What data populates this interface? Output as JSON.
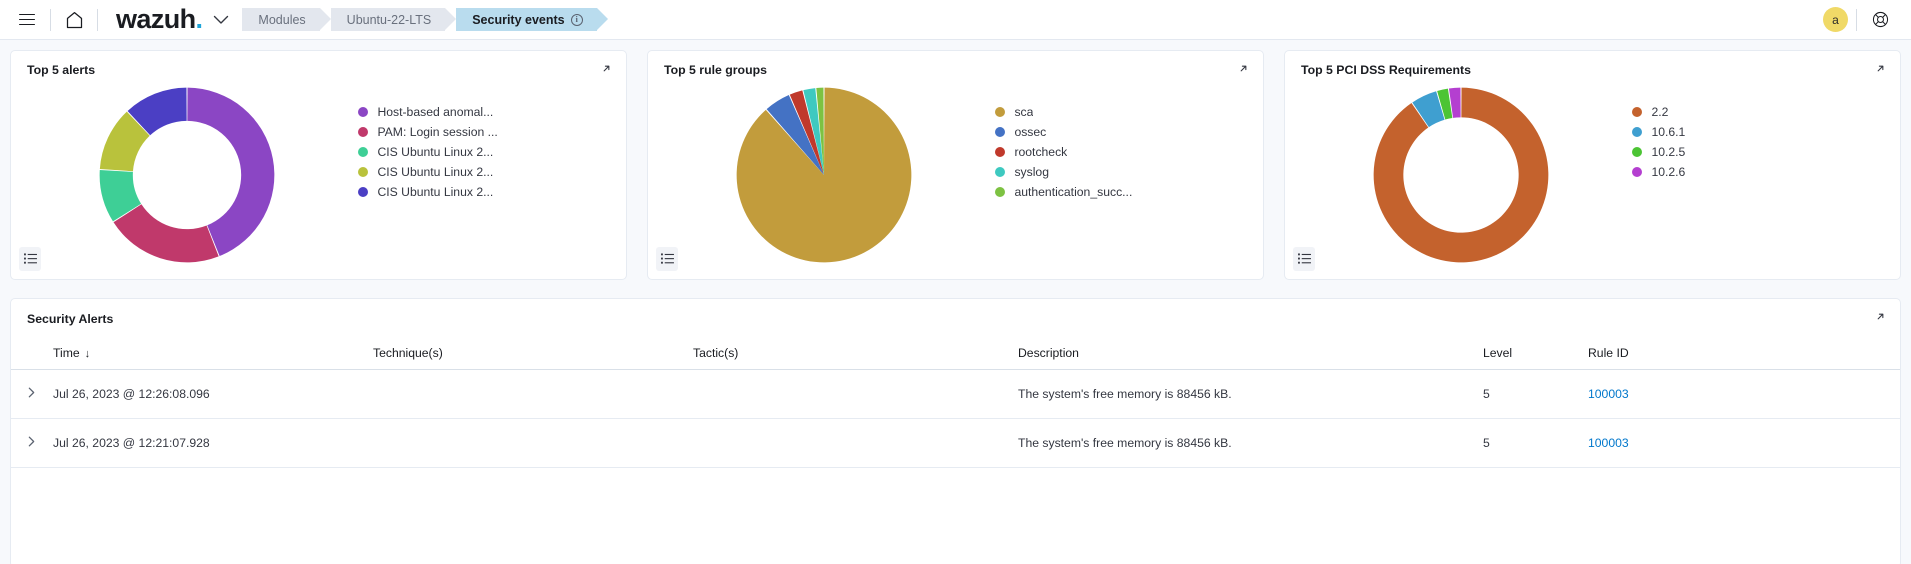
{
  "header": {
    "menu_icon": "hamburger-menu-icon",
    "home_icon": "home-icon",
    "logo_text": "wazuh",
    "logo_dot": ".",
    "chevron_icon": "chevron-down-icon",
    "breadcrumbs": [
      {
        "label": "Modules",
        "active": false
      },
      {
        "label": "Ubuntu-22-LTS",
        "active": false
      },
      {
        "label": "Security events",
        "active": true,
        "info_icon": "info-circle-icon",
        "info_glyph": "i"
      }
    ],
    "avatar_initial": "a",
    "avatar_color": "#f0d967",
    "help_icon": "help-lifebuoy-icon"
  },
  "panels": [
    {
      "title": "Top 5 alerts",
      "expand_icon": "expand-panel-icon",
      "inspect_icon": "inspect-list-icon",
      "chart_data": {
        "type": "pie",
        "title": "Top 5 alerts",
        "donut": true,
        "inner_radius_ratio": 0.62,
        "legend_position": "right",
        "labels": [
          "Host-based anomal...",
          "PAM: Login session ...",
          "CIS Ubuntu Linux 2...",
          "CIS Ubuntu Linux 2...",
          "CIS Ubuntu Linux 2..."
        ],
        "values": [
          44,
          22,
          10,
          12,
          12
        ],
        "colors": [
          "#8b46c4",
          "#c0396b",
          "#3ecf96",
          "#b9c23c",
          "#4b3fc4"
        ]
      }
    },
    {
      "title": "Top 5 rule groups",
      "expand_icon": "expand-panel-icon",
      "inspect_icon": "inspect-list-icon",
      "chart_data": {
        "type": "pie",
        "title": "Top 5 rule groups",
        "donut": false,
        "inner_radius_ratio": 0,
        "legend_position": "right",
        "labels": [
          "sca",
          "ossec",
          "rootcheck",
          "syslog",
          "authentication_succ..."
        ],
        "values": [
          88.5,
          5.0,
          2.6,
          2.4,
          1.5
        ],
        "colors": [
          "#c29c3c",
          "#4472c4",
          "#c0392b",
          "#3ec9c0",
          "#7dc242"
        ]
      }
    },
    {
      "title": "Top 5 PCI DSS Requirements",
      "expand_icon": "expand-panel-icon",
      "inspect_icon": "inspect-list-icon",
      "chart_data": {
        "type": "pie",
        "title": "Top 5 PCI DSS Requirements",
        "donut": true,
        "inner_radius_ratio": 0.66,
        "legend_position": "right",
        "labels": [
          "2.2",
          "10.6.1",
          "10.2.5",
          "10.2.6"
        ],
        "values": [
          90.5,
          5.0,
          2.2,
          2.3
        ],
        "colors": [
          "#c4622d",
          "#3f9fd0",
          "#4cc434",
          "#b43fd0"
        ]
      }
    }
  ],
  "table": {
    "title": "Security Alerts",
    "expand_icon": "expand-panel-icon",
    "sort_arrow": "↓",
    "row_chevron_icon": "chevron-right-icon",
    "columns": [
      {
        "key": "time",
        "label": "Time",
        "sorted": true
      },
      {
        "key": "tech",
        "label": "Technique(s)",
        "sorted": false
      },
      {
        "key": "tactic",
        "label": "Tactic(s)",
        "sorted": false
      },
      {
        "key": "desc",
        "label": "Description",
        "sorted": false
      },
      {
        "key": "level",
        "label": "Level",
        "sorted": false
      },
      {
        "key": "rule",
        "label": "Rule ID",
        "sorted": false
      }
    ],
    "rows": [
      {
        "time": "Jul 26, 2023 @ 12:26:08.096",
        "tech": "",
        "tactic": "",
        "desc": "The system's free memory is 88456 kB.",
        "level": "5",
        "rule": "100003"
      },
      {
        "time": "Jul 26, 2023 @ 12:21:07.928",
        "tech": "",
        "tactic": "",
        "desc": "The system's free memory is 88456 kB.",
        "level": "5",
        "rule": "100003"
      }
    ]
  }
}
